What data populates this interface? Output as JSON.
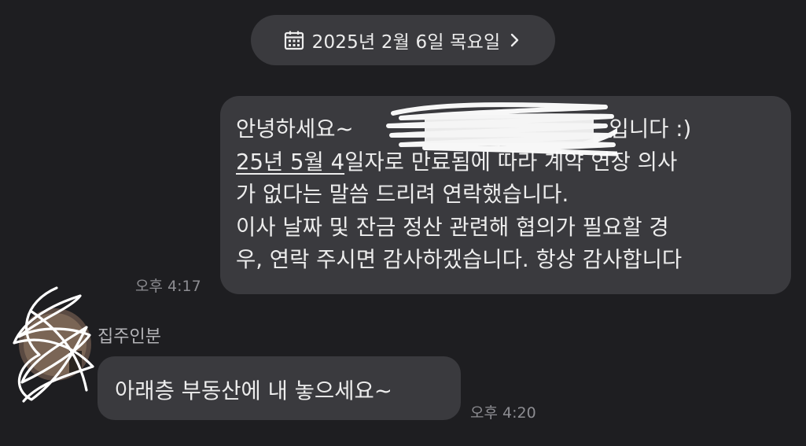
{
  "date_header": {
    "icon": "calendar-icon",
    "text": "2025년 2월 6일 목요일",
    "chevron": "chevron-right-icon"
  },
  "outgoing_message": {
    "line1_prefix": "안녕하세요~",
    "line1_suffix": "입니다 :)",
    "line2_underlined": "25년 5월 4",
    "line2_rest": "일자로 만료됨에 따라 계약 연장 의사",
    "line3": "가 없다는 말씀 드리려 연락했습니다.",
    "line4": "이사 날짜 및 잔금 정산 관련해 협의가 필요할 경",
    "line5": "우, 연락 주시면 감사하겠습니다. 항상 감사합니다",
    "time": "오후 4:17"
  },
  "incoming_message": {
    "sender": "집주인분",
    "text": "아래층 부동산에 내 놓으세요~",
    "time": "오후 4:20"
  },
  "colors": {
    "background": "#1e1e21",
    "bubble": "#3a3a3e",
    "text": "#ededed",
    "timestamp": "#8d8d92",
    "sender": "#b4b4b8",
    "scribble": "#ffffff"
  }
}
